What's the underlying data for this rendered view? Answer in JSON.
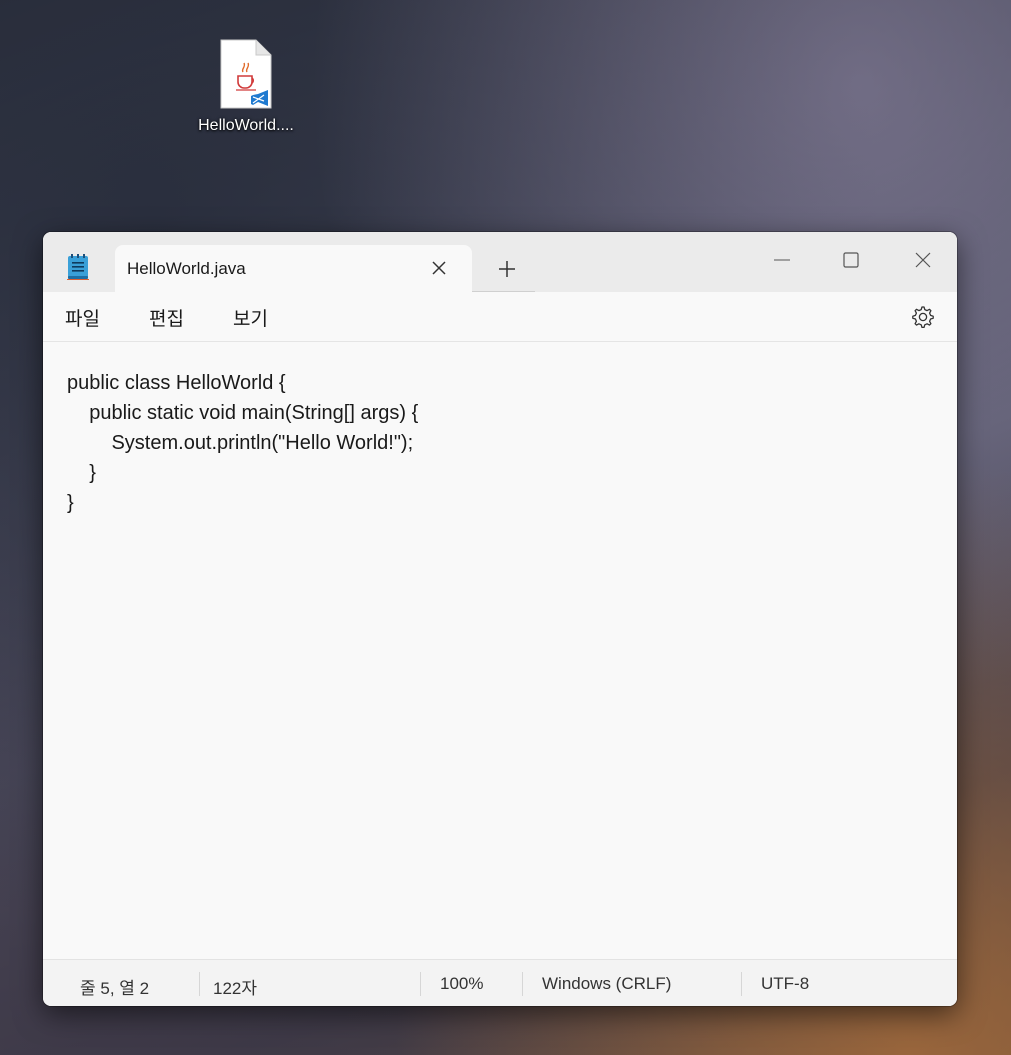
{
  "desktop": {
    "file_icon": {
      "icon": "java-file-icon",
      "label": "HelloWorld...."
    }
  },
  "window": {
    "app_icon": "notepad-icon",
    "tab": {
      "label": "HelloWorld.java",
      "close_icon": "close-icon"
    },
    "new_tab_icon": "plus-icon",
    "controls": [
      "minimize-icon",
      "maximize-icon",
      "close-icon"
    ]
  },
  "menu": {
    "file": "파일",
    "edit": "편집",
    "view": "보기",
    "settings_icon": "gear-icon"
  },
  "editor": {
    "content": "public class HelloWorld {\n    public static void main(String[] args) {\n        System.out.println(\"Hello World!\");\n    }\n}"
  },
  "status": {
    "position": "줄 5, 열 2",
    "chars": "122자",
    "zoom": "100%",
    "line_ending": "Windows (CRLF)",
    "encoding": "UTF-8"
  },
  "colors": {
    "window_bg": "#f9f9f9",
    "titlebar_bg": "#ebebeb",
    "statusbar_bg": "#f3f3f3"
  }
}
